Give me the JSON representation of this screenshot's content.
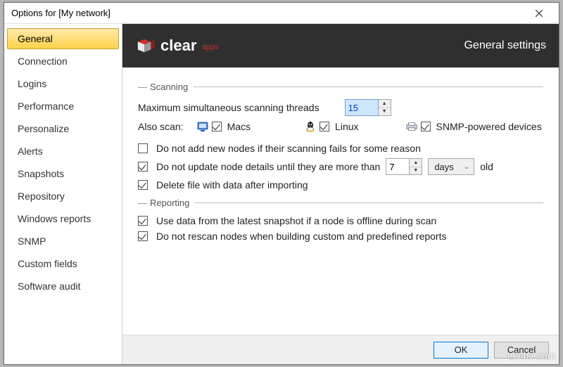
{
  "window": {
    "title": "Options for [My network]"
  },
  "sidebar": {
    "items": [
      {
        "label": "General",
        "selected": true
      },
      {
        "label": "Connection",
        "selected": false
      },
      {
        "label": "Logins",
        "selected": false
      },
      {
        "label": "Performance",
        "selected": false
      },
      {
        "label": "Personalize",
        "selected": false
      },
      {
        "label": "Alerts",
        "selected": false
      },
      {
        "label": "Snapshots",
        "selected": false
      },
      {
        "label": "Repository",
        "selected": false
      },
      {
        "label": "Windows reports",
        "selected": false
      },
      {
        "label": "SNMP",
        "selected": false
      },
      {
        "label": "Custom fields",
        "selected": false
      },
      {
        "label": "Software audit",
        "selected": false
      }
    ]
  },
  "header": {
    "brand_main": "clear",
    "brand_sub": "apps",
    "title": "General settings"
  },
  "scanning": {
    "group_label": "Scanning",
    "max_threads_label": "Maximum simultaneous scanning threads",
    "max_threads_value": "15",
    "also_scan_label": "Also scan:",
    "scan_macs": {
      "label": "Macs",
      "checked": true
    },
    "scan_linux": {
      "label": "Linux",
      "checked": true
    },
    "scan_snmp": {
      "label": "SNMP-powered devices",
      "checked": true
    },
    "no_add_failed": {
      "label": "Do not add new nodes if their scanning fails for some reason",
      "checked": false
    },
    "no_update_until": {
      "label_before": "Do not update node details until they are more than",
      "value": "7",
      "unit": "days",
      "label_after": "old",
      "checked": true
    },
    "delete_after_import": {
      "label": "Delete file with data after importing",
      "checked": true
    }
  },
  "reporting": {
    "group_label": "Reporting",
    "use_latest_snapshot": {
      "label": "Use data from the latest snapshot if a node is offline during scan",
      "checked": true
    },
    "no_rescan_reports": {
      "label": "Do not rescan nodes when building custom and predefined reports",
      "checked": true
    }
  },
  "buttons": {
    "ok": "OK",
    "cancel": "Cancel"
  },
  "watermark": "LO4D.com"
}
